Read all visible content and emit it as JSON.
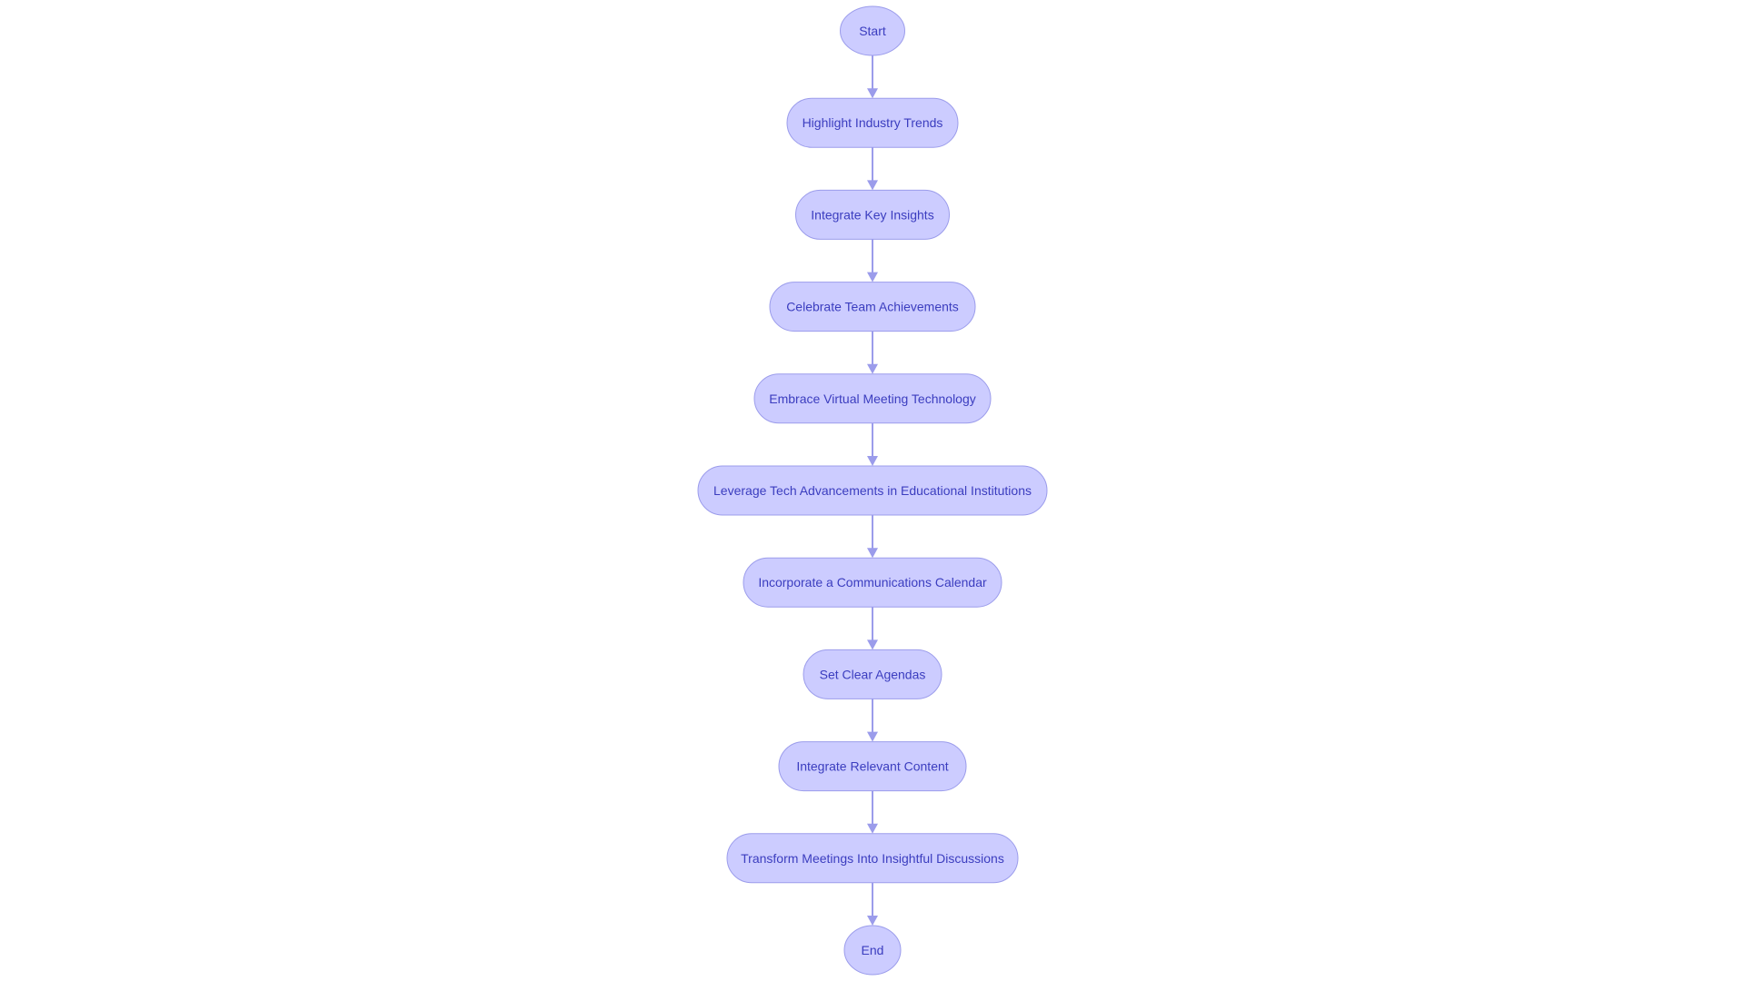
{
  "diagram": {
    "type": "flowchart",
    "direction": "top-to-bottom",
    "colors": {
      "node_fill": "#ccccff",
      "node_stroke": "#9b9ceb",
      "text": "#3b3dbf",
      "edge": "#9b9ceb"
    },
    "nodes": [
      {
        "id": "start",
        "label": "Start"
      },
      {
        "id": "n1",
        "label": "Highlight Industry Trends"
      },
      {
        "id": "n2",
        "label": "Integrate Key Insights"
      },
      {
        "id": "n3",
        "label": "Celebrate Team Achievements"
      },
      {
        "id": "n4",
        "label": "Embrace Virtual Meeting Technology"
      },
      {
        "id": "n5",
        "label": "Leverage Tech Advancements in Educational Institutions"
      },
      {
        "id": "n6",
        "label": "Incorporate a Communications Calendar"
      },
      {
        "id": "n7",
        "label": "Set Clear Agendas"
      },
      {
        "id": "n8",
        "label": "Integrate Relevant Content"
      },
      {
        "id": "n9",
        "label": "Transform Meetings Into Insightful Discussions"
      },
      {
        "id": "end",
        "label": "End"
      }
    ],
    "edges": [
      {
        "from": "start",
        "to": "n1"
      },
      {
        "from": "n1",
        "to": "n2"
      },
      {
        "from": "n2",
        "to": "n3"
      },
      {
        "from": "n3",
        "to": "n4"
      },
      {
        "from": "n4",
        "to": "n5"
      },
      {
        "from": "n5",
        "to": "n6"
      },
      {
        "from": "n6",
        "to": "n7"
      },
      {
        "from": "n7",
        "to": "n8"
      },
      {
        "from": "n8",
        "to": "n9"
      },
      {
        "from": "n9",
        "to": "end"
      }
    ]
  }
}
